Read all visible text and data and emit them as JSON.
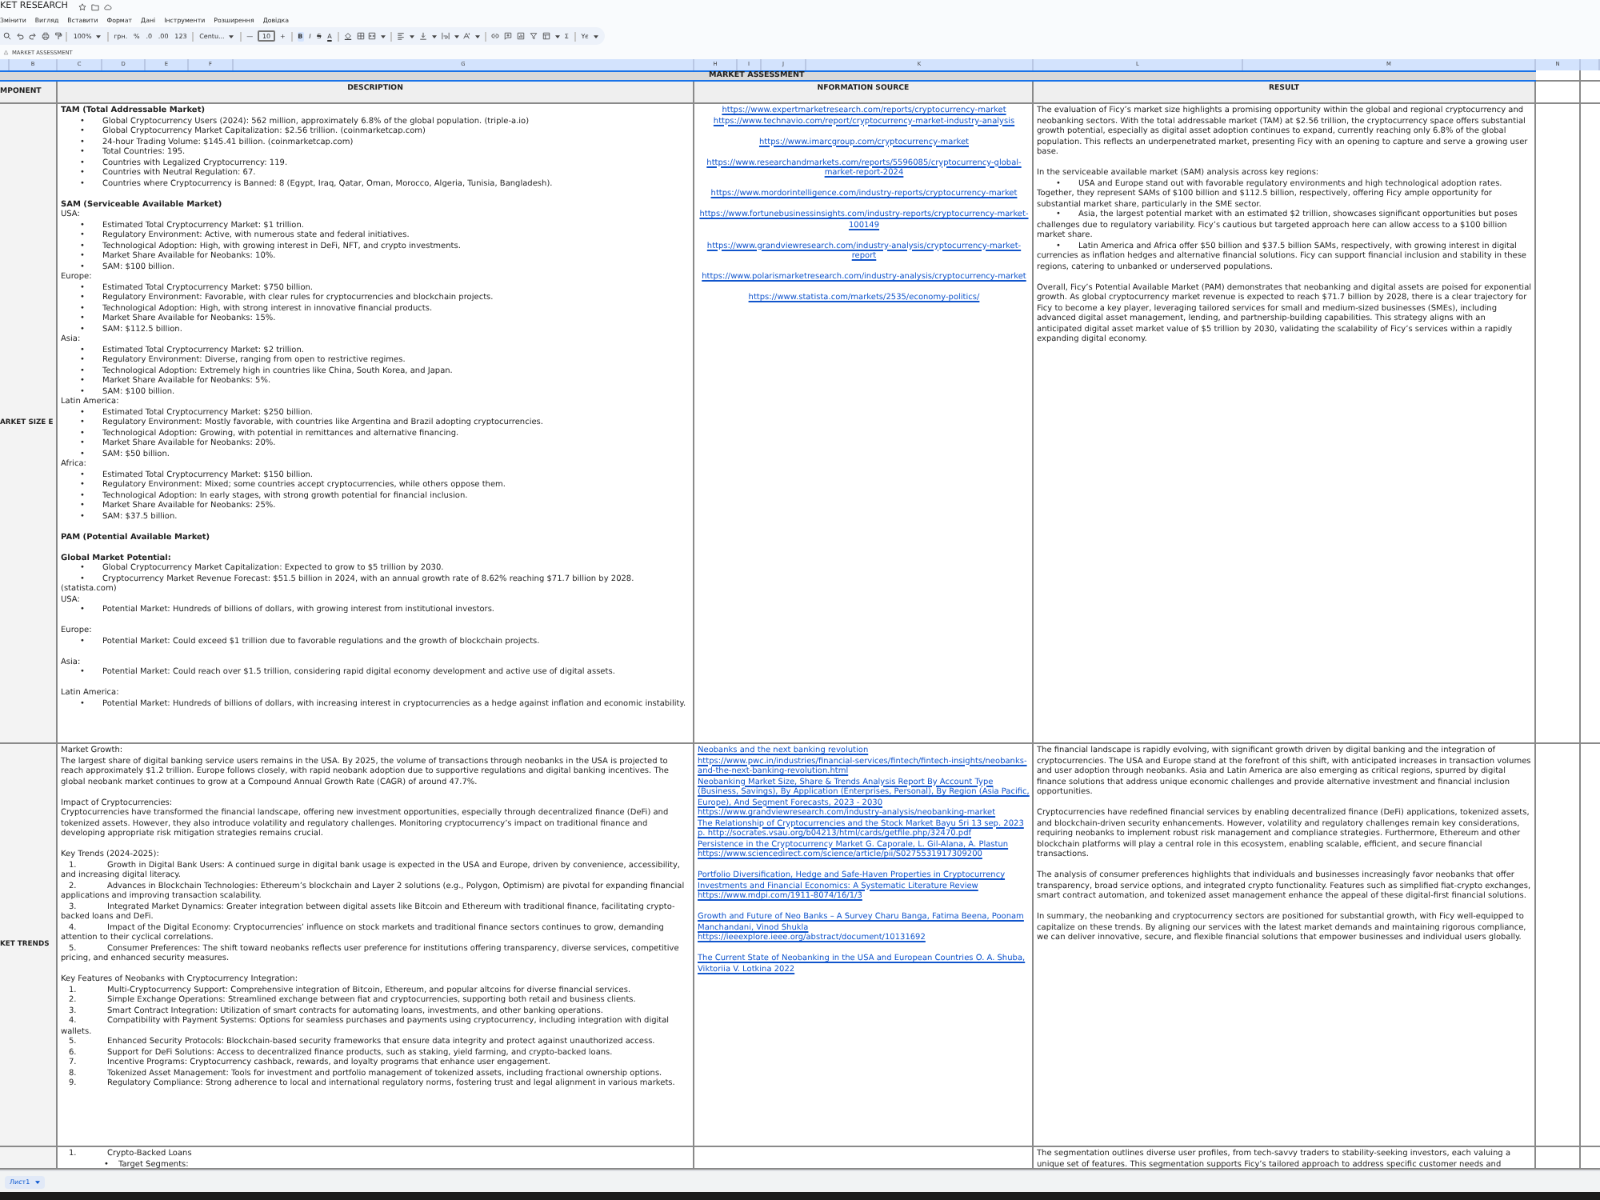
{
  "title_bar": {
    "title": "KET RESEARCH"
  },
  "menu": [
    "Змінити",
    "Вигляд",
    "Вставити",
    "Формат",
    "Дані",
    "Інструменти",
    "Розширення",
    "Довідка"
  ],
  "toolbar": {
    "zoom": "100%",
    "currency": "грн.",
    "percent": "%",
    "decimals_decrease": ".0",
    "decimals_increase": ".00",
    "number_format": "123",
    "font": "Centu...",
    "font_size_minus": "—",
    "font_size": "10",
    "font_size_plus": "+",
    "bold": "B",
    "italic": "I",
    "strikethrough": "S",
    "text_color": "A",
    "functions": "Σ",
    "input_tools": "Yє"
  },
  "formula_bar": {
    "content": "MARKET ASSESSMENT"
  },
  "column_headers": [
    "B",
    "C",
    "D",
    "E",
    "F",
    "G",
    "H",
    "I",
    "J",
    "K",
    "L",
    "M",
    "N"
  ],
  "sheet": {
    "banner": "MARKET ASSESSMENT",
    "headers": {
      "component": "MPONENT",
      "description": "DESCRIPTION",
      "source": "NFORMATION SOURCE",
      "result": "RESULT"
    },
    "rows": [
      {
        "component": "ARKET SIZE E",
        "description": [
          [
            {
              "kind": "heading",
              "text": "TAM (Total Addressable Market)"
            },
            {
              "kind": "bullet",
              "marker": "•",
              "text": "Global Cryptocurrency Users (2024): 562 million, approximately 6.8% of the global population. (triple-a.io)"
            },
            {
              "kind": "bullet",
              "marker": "•",
              "text": "Global Cryptocurrency Market Capitalization: $2.56 trillion. (coinmarketcap.com)"
            },
            {
              "kind": "bullet",
              "marker": "•",
              "text": "24-hour Trading Volume: $145.41 billion. (coinmarketcap.com)"
            },
            {
              "kind": "bullet",
              "marker": "•",
              "text": "Total Countries: 195."
            },
            {
              "kind": "bullet",
              "marker": "•",
              "text": "Countries with Legalized Cryptocurrency: 119."
            },
            {
              "kind": "bullet",
              "marker": "•",
              "text": "Countries with Neutral Regulation: 67."
            },
            {
              "kind": "bullet",
              "marker": "•",
              "text": "Countries where Cryptocurrency is Banned: 8 (Egypt, Iraq, Qatar, Oman, Morocco, Algeria, Tunisia, Bangladesh)."
            }
          ],
          [
            {
              "kind": "heading",
              "text": "SAM (Serviceable Available Market)"
            },
            {
              "kind": "text",
              "text": "USA:"
            },
            {
              "kind": "bullet",
              "marker": "•",
              "text": "Estimated Total Cryptocurrency Market: $1 trillion."
            },
            {
              "kind": "bullet",
              "marker": "•",
              "text": "Regulatory Environment: Active, with numerous state and federal initiatives."
            },
            {
              "kind": "bullet",
              "marker": "•",
              "text": "Technological Adoption: High, with growing interest in DeFi, NFT, and crypto investments."
            },
            {
              "kind": "bullet",
              "marker": "•",
              "text": "Market Share Available for Neobanks: 10%."
            },
            {
              "kind": "bullet",
              "marker": "•",
              "text": "SAM: $100 billion."
            },
            {
              "kind": "text",
              "text": "Europe:"
            },
            {
              "kind": "bullet",
              "marker": "•",
              "text": "Estimated Total Cryptocurrency Market: $750 billion."
            },
            {
              "kind": "bullet",
              "marker": "•",
              "text": "Regulatory Environment: Favorable, with clear rules for cryptocurrencies and blockchain projects."
            },
            {
              "kind": "bullet",
              "marker": "•",
              "text": "Technological Adoption: High, with strong interest in innovative financial products."
            },
            {
              "kind": "bullet",
              "marker": "•",
              "text": "Market Share Available for Neobanks: 15%."
            },
            {
              "kind": "bullet",
              "marker": "•",
              "text": "SAM: $112.5 billion."
            },
            {
              "kind": "text",
              "text": "Asia:"
            },
            {
              "kind": "bullet",
              "marker": "•",
              "text": "Estimated Total Cryptocurrency Market: $2 trillion."
            },
            {
              "kind": "bullet",
              "marker": "•",
              "text": "Regulatory Environment: Diverse, ranging from open to restrictive regimes."
            },
            {
              "kind": "bullet",
              "marker": "•",
              "text": "Technological Adoption: Extremely high in countries like China, South Korea, and Japan."
            },
            {
              "kind": "bullet",
              "marker": "•",
              "text": "Market Share Available for Neobanks: 5%."
            },
            {
              "kind": "bullet",
              "marker": "•",
              "text": "SAM: $100 billion."
            },
            {
              "kind": "text",
              "text": "Latin America:"
            },
            {
              "kind": "bullet",
              "marker": "•",
              "text": "Estimated Total Cryptocurrency Market: $250 billion."
            },
            {
              "kind": "bullet",
              "marker": "•",
              "text": "Regulatory Environment: Mostly favorable, with countries like Argentina and Brazil adopting cryptocurrencies."
            },
            {
              "kind": "bullet",
              "marker": "•",
              "text": "Technological Adoption: Growing, with potential in remittances and alternative financing."
            },
            {
              "kind": "bullet",
              "marker": "•",
              "text": "Market Share Available for Neobanks: 20%."
            },
            {
              "kind": "bullet",
              "marker": "•",
              "text": "SAM: $50 billion."
            },
            {
              "kind": "text",
              "text": "Africa:"
            },
            {
              "kind": "bullet",
              "marker": "•",
              "text": "Estimated Total Cryptocurrency Market: $150 billion."
            },
            {
              "kind": "bullet",
              "marker": "•",
              "text": "Regulatory Environment: Mixed; some countries accept cryptocurrencies, while others oppose them."
            },
            {
              "kind": "bullet",
              "marker": "•",
              "text": "Technological Adoption: In early stages, with strong growth potential for financial inclusion."
            },
            {
              "kind": "bullet",
              "marker": "•",
              "text": "Market Share Available for Neobanks: 25%."
            },
            {
              "kind": "bullet",
              "marker": "•",
              "text": "SAM: $37.5 billion."
            }
          ],
          [
            {
              "kind": "heading",
              "text": "PAM (Potential Available Market)"
            }
          ],
          [
            {
              "kind": "heading",
              "text": "Global Market Potential:"
            },
            {
              "kind": "bullet",
              "marker": "•",
              "text": "Global Cryptocurrency Market Capitalization: Expected to grow to $5 trillion by 2030."
            },
            {
              "kind": "bullet",
              "marker": "•",
              "text": "Cryptocurrency Market Revenue Forecast: $51.5 billion in 2024, with an annual growth rate of 8.62% reaching $71.7 billion by 2028. (statista.com)"
            },
            {
              "kind": "text",
              "text": "USA:"
            },
            {
              "kind": "bullet",
              "marker": "•",
              "text": "Potential Market: Hundreds of billions of dollars, with growing interest from institutional investors."
            }
          ],
          [
            {
              "kind": "text",
              "text": "Europe:"
            },
            {
              "kind": "bullet",
              "marker": "•",
              "text": "Potential Market: Could exceed $1 trillion due to favorable regulations and the growth of blockchain projects."
            }
          ],
          [
            {
              "kind": "text",
              "text": "Asia:"
            },
            {
              "kind": "bullet",
              "marker": "•",
              "text": "Potential Market: Could reach over $1.5 trillion, considering rapid digital economy development and active use of digital assets."
            }
          ],
          [
            {
              "kind": "text",
              "text": "Latin America:"
            },
            {
              "kind": "bullet",
              "marker": "•",
              "text": "Potential Market: Hundreds of billions of dollars, with increasing interest in cryptocurrencies as a hedge against inflation and economic instability."
            }
          ]
        ],
        "sources": [
          [
            "https://www.expertmarketresearch.com/reports/cryptocurrency-market",
            "https://www.technavio.com/report/cryptocurrency-market-industry-analysis"
          ],
          [
            "https://www.imarcgroup.com/cryptocurrency-market"
          ],
          [
            "https://www.researchandmarkets.com/reports/5596085/cryptocurrency-global-market-report-2024"
          ],
          [
            "https://www.mordorintelligence.com/industry-reports/cryptocurrency-market"
          ],
          [
            "https://www.fortunebusinessinsights.com/industry-reports/cryptocurrency-market-100149"
          ],
          [
            "https://www.grandviewresearch.com/industry-analysis/cryptocurrency-market-report"
          ],
          [
            "https://www.polarismarketresearch.com/industry-analysis/cryptocurrency-market"
          ],
          [
            "https://www.statista.com/markets/2535/economy-politics/"
          ]
        ],
        "result": [
          [
            {
              "kind": "text",
              "text": "The evaluation of Ficy’s market size highlights a promising opportunity within the global and regional cryptocurrency and neobanking sectors. With the total addressable market (TAM) at $2.56 trillion, the cryptocurrency space offers substantial growth potential, especially as digital asset adoption continues to expand, currently reaching only 6.8% of the global population. This reflects an underpenetrated market, presenting Ficy with an opening to capture and serve a growing user base."
            }
          ],
          [
            {
              "kind": "text",
              "text": "In the serviceable available market (SAM) analysis across key regions:"
            },
            {
              "kind": "bullet",
              "marker": "•",
              "text": "USA and Europe stand out with favorable regulatory environments and high technological adoption rates. Together, they represent SAMs of $100 billion and $112.5 billion, respectively, offering Ficy ample opportunity for substantial market share, particularly in the SME sector."
            },
            {
              "kind": "bullet",
              "marker": "•",
              "text": "Asia, the largest potential market with an estimated $2 trillion, showcases significant opportunities but poses challenges due to regulatory variability. Ficy’s cautious but targeted approach here can allow access to a $100 billion market share."
            },
            {
              "kind": "bullet",
              "marker": "•",
              "text": "Latin America and Africa offer $50 billion and $37.5 billion SAMs, respectively, with growing interest in digital currencies as inflation hedges and alternative financial solutions. Ficy can support financial inclusion and stability in these regions, catering to unbanked or underserved populations."
            }
          ],
          [
            {
              "kind": "text",
              "text": "Overall, Ficy’s Potential Available Market (PAM) demonstrates that neobanking and digital assets are poised for exponential growth. As global cryptocurrency market revenue is expected to reach $71.7 billion by 2028, there is a clear trajectory for Ficy to become a key player, leveraging tailored services for small and medium-sized businesses (SMEs), including advanced digital asset management, lending, and partnership-building capabilities. This strategy aligns with an anticipated digital asset market value of $5 trillion by 2030, validating the scalability of Ficy’s services within a rapidly expanding digital economy."
            }
          ]
        ]
      },
      {
        "component": "KET TRENDS",
        "description": [
          [
            {
              "kind": "text",
              "text": "Market Growth:"
            },
            {
              "kind": "text",
              "text": "The largest share of digital banking service users remains in the USA. By 2025, the volume of transactions through neobanks in the USA is projected to reach approximately $1.2 trillion. Europe follows closely, with rapid neobank adoption due to supportive regulations and digital banking incentives. The global neobank market continues to grow at a Compound Annual Growth Rate (CAGR) of around 47.7%."
            }
          ],
          [
            {
              "kind": "text",
              "text": "Impact of Cryptocurrencies:"
            },
            {
              "kind": "text",
              "text": "Cryptocurrencies have transformed the financial landscape, offering new investment opportunities, especially through decentralized finance (DeFi) and tokenized assets. However, they also introduce volatility and regulatory challenges. Monitoring cryptocurrency’s impact on traditional finance and developing appropriate risk mitigation strategies remains crucial."
            }
          ],
          [
            {
              "kind": "text",
              "text": "Key Trends (2024-2025):"
            },
            {
              "kind": "numbered",
              "marker": "1.",
              "text": "Growth in Digital Bank Users: A continued surge in digital bank usage is expected in the USA and Europe, driven by convenience, accessibility, and increasing digital literacy."
            },
            {
              "kind": "numbered",
              "marker": "2.",
              "text": "Advances in Blockchain Technologies: Ethereum’s blockchain and Layer 2 solutions (e.g., Polygon, Optimism) are pivotal for expanding financial applications and improving transaction scalability."
            },
            {
              "kind": "numbered",
              "marker": "3.",
              "text": "Integrated Market Dynamics: Greater integration between digital assets like Bitcoin and Ethereum with traditional finance, facilitating crypto-backed loans and DeFi."
            },
            {
              "kind": "numbered",
              "marker": "4.",
              "text": "Impact of the Digital Economy: Cryptocurrencies’ influence on stock markets and traditional finance sectors continues to grow, demanding attention to their cyclical correlations."
            },
            {
              "kind": "numbered",
              "marker": "5.",
              "text": "Consumer Preferences: The shift toward neobanks reflects user preference for institutions offering transparency, diverse services, competitive pricing, and enhanced security measures."
            }
          ],
          [
            {
              "kind": "text",
              "text": "Key Features of Neobanks with Cryptocurrency Integration:"
            },
            {
              "kind": "numbered",
              "marker": "1.",
              "text": "Multi-Cryptocurrency Support: Comprehensive integration of Bitcoin, Ethereum, and popular altcoins for diverse financial services."
            },
            {
              "kind": "numbered",
              "marker": "2.",
              "text": "Simple Exchange Operations: Streamlined exchange between fiat and cryptocurrencies, supporting both retail and business clients."
            },
            {
              "kind": "numbered",
              "marker": "3.",
              "text": "Smart Contract Integration: Utilization of smart contracts for automating loans, investments, and other banking operations."
            },
            {
              "kind": "numbered",
              "marker": "4.",
              "text": "Compatibility with Payment Systems: Options for seamless purchases and payments using cryptocurrency, including integration with digital wallets."
            },
            {
              "kind": "numbered",
              "marker": "5.",
              "text": "Enhanced Security Protocols: Blockchain-based security frameworks that ensure data integrity and protect against unauthorized access."
            },
            {
              "kind": "numbered",
              "marker": "6.",
              "text": "Support for DeFi Solutions: Access to decentralized finance products, such as staking, yield farming, and crypto-backed loans."
            },
            {
              "kind": "numbered",
              "marker": "7.",
              "text": "Incentive Programs: Cryptocurrency cashback, rewards, and loyalty programs that enhance user engagement."
            },
            {
              "kind": "numbered",
              "marker": "8.",
              "text": "Tokenized Asset Management: Tools for investment and portfolio management of tokenized assets, including fractional ownership options."
            },
            {
              "kind": "numbered",
              "marker": "9.",
              "text": "Regulatory Compliance: Strong adherence to local and international regulatory norms, fostering trust and legal alignment in various markets."
            }
          ]
        ],
        "sources": [
          [
            "Neobanks and the next banking revolution",
            "https://www.pwc.in/industries/financial-services/fintech/fintech-insights/neobanks-and-the-next-banking-revolution.html",
            "Neobanking Market Size, Share & Trends Analysis Report By Account Type (Business, Savings), By Application (Enterprises, Personal), By Region (Asia Pacific, Europe), And Segment Forecasts, 2023 - 2030",
            "https://www.grandviewresearch.com/industry-analysis/neobanking-market",
            "The Relationship of Cryptocurrencies and the Stock Market Bayu Sri 13 sep. 2023 p. http://socrates.vsau.org/b04213/html/cards/getfile.php/32470.pdf",
            " Persistence in the Cryptocurrency Market G. Caporale, L. Gil-Alana, A. Plastun https://www.sciencedirect.com/science/article/pii/S0275531917309200"
          ],
          [
            "Portfolio Diversification, Hedge and Safe-Haven Properties in Cryptocurrency Investments and Financial Economics: A Systematic Literature Review https://www.mdpi.com/1911-8074/16/1/3"
          ],
          [
            "Growth and Future of Neo Banks – A Survey Charu Banga, Fatima Beena, Poonam Manchandani, Vinod Shukla https://ieeexplore.ieee.org/abstract/document/10131692"
          ],
          [
            "The Current State of Neobanking in the USA and European Countries O. A. Shuba, Viktoriia V. Lotkina 2022"
          ]
        ],
        "result": [
          [
            {
              "kind": "text",
              "text": "The financial landscape is rapidly evolving, with significant growth driven by digital banking and the integration of cryptocurrencies. The USA and Europe stand at the forefront of this shift, with anticipated increases in transaction volumes and user adoption through neobanks. Asia and Latin America are also emerging as critical regions, spurred by digital finance solutions that address unique economic challenges and provide alternative investment and financial inclusion opportunities."
            }
          ],
          [
            {
              "kind": "text",
              "text": "Cryptocurrencies have redefined financial services by enabling decentralized finance (DeFi) applications, tokenized assets, and blockchain-driven security enhancements. However, volatility and regulatory challenges remain key considerations, requiring neobanks to implement robust risk management and compliance strategies. Furthermore, Ethereum and other blockchain platforms will play a central role in this ecosystem, enabling scalable, efficient, and secure financial transactions."
            }
          ],
          [
            {
              "kind": "text",
              "text": "The analysis of consumer preferences highlights that individuals and businesses increasingly favor neobanks that offer transparency, broad service options, and integrated crypto functionality. Features such as simplified fiat-crypto exchanges, smart contract automation, and tokenized asset management enhance the appeal of these digital-first financial solutions."
            }
          ],
          [
            {
              "kind": "text",
              "text": "In summary, the neobanking and cryptocurrency sectors are positioned for substantial growth, with Ficy well-equipped to capitalize on these trends. By aligning our services with the latest market demands and maintaining rigorous compliance, we can deliver innovative, secure, and flexible financial solutions that empower businesses and individual users globally."
            }
          ]
        ]
      },
      {
        "description": [
          [
            {
              "kind": "numbered",
              "marker": "1.",
              "text": "Crypto-Backed Loans",
              "children": [
                {
                  "kind": "bullet",
                  "marker": "•",
                  "text": "Target Segments:"
                }
              ]
            }
          ]
        ],
        "result": [
          [
            {
              "kind": "text",
              "text": "The segmentation outlines diverse user profiles, from tech-savvy traders to stability-seeking investors, each valuing a unique set of features. This segmentation supports Ficy’s tailored approach to address specific customer needs and"
            }
          ]
        ]
      }
    ]
  },
  "sheet_tabs": [
    {
      "label": "Лист1",
      "selected": true
    }
  ]
}
